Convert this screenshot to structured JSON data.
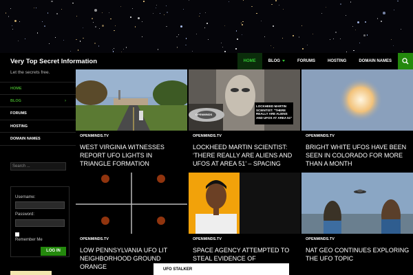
{
  "site": {
    "title": "Very Top Secret Information",
    "tagline": "Let the secrets free."
  },
  "top_nav": {
    "items": [
      {
        "label": "HOME",
        "active": true
      },
      {
        "label": "BLOG",
        "has_submenu": true
      },
      {
        "label": "FORUMS"
      },
      {
        "label": "HOSTING"
      },
      {
        "label": "DOMAIN NAMES"
      }
    ],
    "search_icon": "search-icon"
  },
  "sidebar": {
    "items": [
      {
        "label": "HOME",
        "active": true
      },
      {
        "label": "BLOG",
        "has_submenu": true
      },
      {
        "label": "FORUMS"
      },
      {
        "label": "HOSTING"
      },
      {
        "label": "DOMAIN NAMES"
      }
    ],
    "search_placeholder": "Search ..."
  },
  "login": {
    "username_label": "Username:",
    "password_label": "Password:",
    "remember_label": "Remember Me",
    "button_label": "LOG IN"
  },
  "posts": [
    {
      "source": "OPENMINDS.TV",
      "title": "WEST VIRGINIA WITNESSES REPORT UFO LIGHTS IN TRIANGLE FORMATION",
      "thumb_overlay": "",
      "thumb_badge": ""
    },
    {
      "source": "OPENMINDS.TV",
      "title": "LOCKHEED MARTIN SCIENTIST: ‘THERE REALLY ARE ALIENS AND UFOS AT AREA 51’ – SPACING",
      "thumb_overlay": "LOCKHEED MARTIN SCIENTIST: \"THERE REALLY ARE ALIENS AND UFOS AT AREA 51\"",
      "thumb_badge": "OPENMINDS"
    },
    {
      "source": "OPENMINDS.TV",
      "title": "BRIGHT WHITE UFOS HAVE BEEN SEEN IN COLORADO FOR MORE THAN A MONTH",
      "thumb_overlay": "",
      "thumb_badge": ""
    },
    {
      "source": "OPENMINDS.TV",
      "title": "LOW PENNSYLVANIA UFO LIT NEIGHBORHOOD GROUND ORANGE",
      "thumb_overlay": "",
      "thumb_badge": ""
    },
    {
      "source": "OPENMINDS.TV",
      "title": "SPACE AGENCY ATTEMPTED TO STEAL EVIDENCE OF",
      "thumb_overlay": "",
      "thumb_badge": ""
    },
    {
      "source": "OPENMINDS.TV",
      "title": "NAT GEO CONTINUES EXPLORING THE UFO TOPIC",
      "thumb_overlay": "",
      "thumb_badge": ""
    }
  ],
  "popup": {
    "label": "UFO STALKER"
  },
  "colors": {
    "accent": "#24890d",
    "active_text": "#41a62a"
  }
}
